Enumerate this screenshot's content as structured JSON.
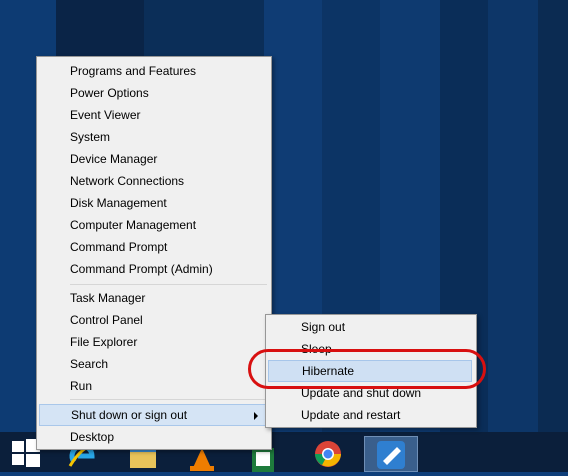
{
  "context_menu": {
    "items": [
      "Programs and Features",
      "Power Options",
      "Event Viewer",
      "System",
      "Device Manager",
      "Network Connections",
      "Disk Management",
      "Computer Management",
      "Command Prompt",
      "Command Prompt (Admin)",
      "Task Manager",
      "Control Panel",
      "File Explorer",
      "Search",
      "Run",
      "Shut down or sign out",
      "Desktop"
    ]
  },
  "shutdown_submenu": {
    "items": [
      "Sign out",
      "Sleep",
      "Hibernate",
      "Update and shut down",
      "Update and restart"
    ]
  },
  "taskbar": {
    "icons": [
      "windows-start-icon",
      "internet-explorer-icon",
      "file-explorer-icon",
      "vlc-icon",
      "excel-icon",
      "chrome-icon",
      "paint-app-icon"
    ]
  },
  "colors": {
    "highlight": "#d5e4f5",
    "annotation": "#d81010",
    "taskbar": "#0b1f3b"
  }
}
